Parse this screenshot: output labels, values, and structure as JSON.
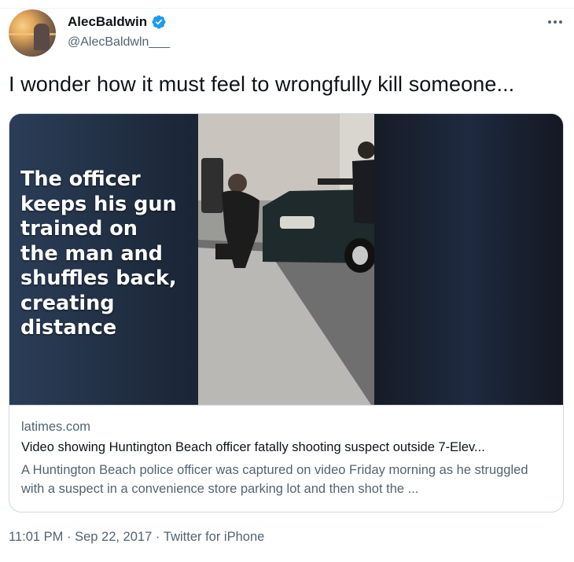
{
  "tweet": {
    "author": {
      "display_name": "AlecBaldwin",
      "handle": "@AlecBaldwln___",
      "verified": true
    },
    "text": "I wonder how it must feel to wrongfully kill someone...",
    "card": {
      "overlay_text": "The officer\nkeeps his gun\ntrained on\nthe man and\nshuffles back,\ncreating\ndistance",
      "domain": "latimes.com",
      "title": "Video showing Huntington Beach officer fatally shooting suspect outside 7-Elev...",
      "description": "A Huntington Beach police officer was captured on video Friday morning as he struggled with a suspect in a convenience store parking lot and then shot the ..."
    },
    "timestamp": {
      "time": "11:01 PM",
      "date": "Sep 22, 2017",
      "source": "Twitter for iPhone",
      "separator": " · "
    }
  },
  "icons": {
    "verified": "verified-badge-icon",
    "more": "more-dots-icon"
  },
  "colors": {
    "verified_blue": "#1d9bf0",
    "text_primary": "#0f1419",
    "text_secondary": "#536471",
    "border": "#cfd9de"
  }
}
